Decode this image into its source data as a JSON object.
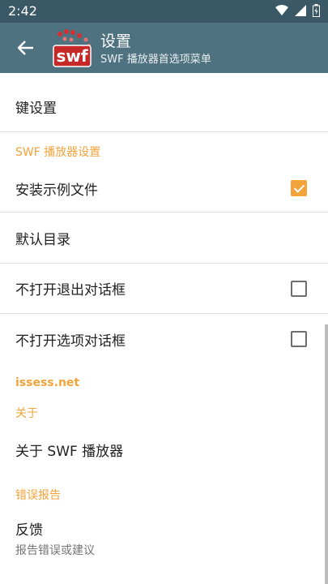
{
  "status_bar": {
    "time": "2:42"
  },
  "app_bar": {
    "title": "设置",
    "subtitle": "SWF 播放器首选项菜单",
    "logo_text": "swf"
  },
  "items": {
    "key_settings": "键设置",
    "swf_category": "SWF 播放器设置",
    "install_samples": "安装示例文件",
    "default_dir": "默认目录",
    "no_exit_dialog": "不打开退出对话框",
    "no_options_dialog": "不打开选项对话框",
    "issess": "issess.net",
    "about_category": "关于",
    "about_swf": "关于 SWF 播放器",
    "error_category": "错误报告",
    "feedback": "反馈",
    "feedback_summary": "报告错误或建议"
  },
  "checkboxes": {
    "install_samples": true,
    "no_exit_dialog": false,
    "no_options_dialog": false
  },
  "colors": {
    "accent": "#f2a33a",
    "app_bar": "#4f7280",
    "status_bar": "#3b5866"
  }
}
